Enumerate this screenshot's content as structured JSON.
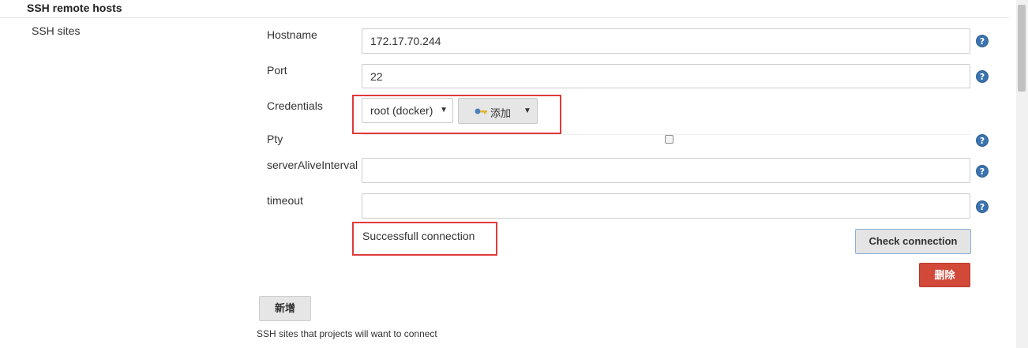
{
  "section": {
    "title": "SSH remote hosts",
    "row_label": "SSH sites"
  },
  "fields": {
    "hostname": {
      "label": "Hostname",
      "value": "172.17.70.244"
    },
    "port": {
      "label": "Port",
      "value": "22"
    },
    "credentials": {
      "label": "Credentials",
      "selected": "root (docker)",
      "add_button_label": "添加",
      "add_icon": "key-icon"
    },
    "pty": {
      "label": "Pty",
      "checked": false
    },
    "server_alive_interval": {
      "label": "serverAliveInterval",
      "value": ""
    },
    "timeout": {
      "label": "timeout",
      "value": ""
    }
  },
  "help_icon": {
    "glyph": "?",
    "icon": "help-icon",
    "color": "#3b73af"
  },
  "status": {
    "text": "Successfull connection"
  },
  "buttons": {
    "check_connection": "Check connection",
    "delete": "删除",
    "add_new": "新增"
  },
  "description": "SSH sites that projects will want to connect",
  "colors": {
    "highlight_box": "#e03a3a",
    "delete_button": "#d24939",
    "help_icon": "#3b73af"
  }
}
